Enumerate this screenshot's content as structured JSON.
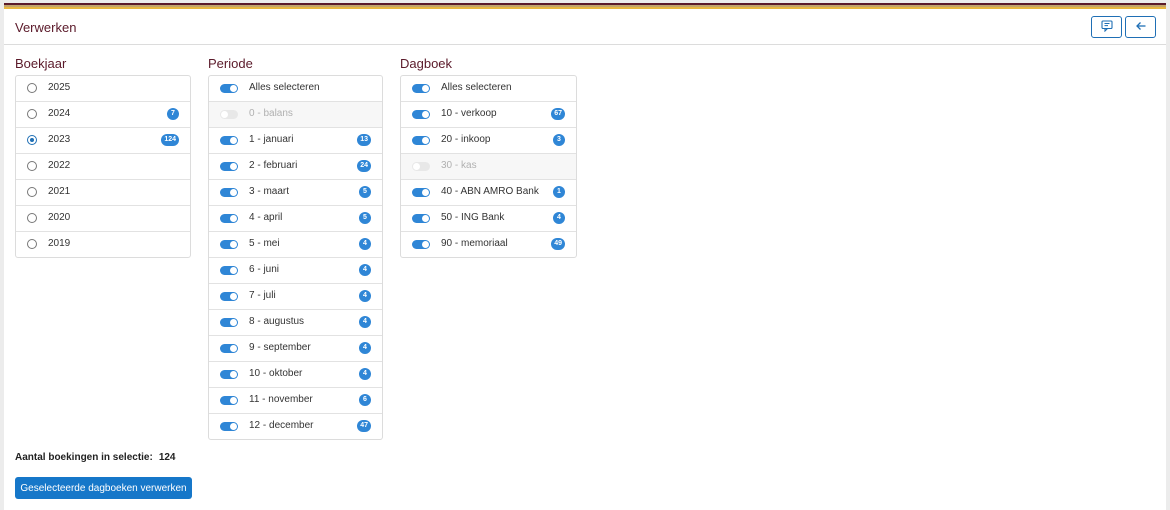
{
  "header": {
    "title": "Verwerken",
    "buttons": [
      {
        "icon": "feedback-icon"
      },
      {
        "icon": "arrow-left-icon"
      }
    ]
  },
  "colors": {
    "accent": "#1677c9",
    "toggle_on": "#2f86d6",
    "title": "#5b1a2a"
  },
  "boekjaar": {
    "title": "Boekjaar",
    "items": [
      {
        "label": "2025",
        "selected": false,
        "badge": ""
      },
      {
        "label": "2024",
        "selected": false,
        "badge": "7"
      },
      {
        "label": "2023",
        "selected": true,
        "badge": "124"
      },
      {
        "label": "2022",
        "selected": false,
        "badge": ""
      },
      {
        "label": "2021",
        "selected": false,
        "badge": ""
      },
      {
        "label": "2020",
        "selected": false,
        "badge": ""
      },
      {
        "label": "2019",
        "selected": false,
        "badge": ""
      }
    ]
  },
  "periode": {
    "title": "Periode",
    "items": [
      {
        "label": "Alles selecteren",
        "on": true,
        "disabled": false,
        "badge": ""
      },
      {
        "label": "0 - balans",
        "on": false,
        "disabled": true,
        "badge": ""
      },
      {
        "label": "1 - januari",
        "on": true,
        "disabled": false,
        "badge": "13"
      },
      {
        "label": "2 - februari",
        "on": true,
        "disabled": false,
        "badge": "24"
      },
      {
        "label": "3 - maart",
        "on": true,
        "disabled": false,
        "badge": "5"
      },
      {
        "label": "4 - april",
        "on": true,
        "disabled": false,
        "badge": "5"
      },
      {
        "label": "5 - mei",
        "on": true,
        "disabled": false,
        "badge": "4"
      },
      {
        "label": "6 - juni",
        "on": true,
        "disabled": false,
        "badge": "4"
      },
      {
        "label": "7 - juli",
        "on": true,
        "disabled": false,
        "badge": "4"
      },
      {
        "label": "8 - augustus",
        "on": true,
        "disabled": false,
        "badge": "4"
      },
      {
        "label": "9 - september",
        "on": true,
        "disabled": false,
        "badge": "4"
      },
      {
        "label": "10 - oktober",
        "on": true,
        "disabled": false,
        "badge": "4"
      },
      {
        "label": "11 - november",
        "on": true,
        "disabled": false,
        "badge": "6"
      },
      {
        "label": "12 - december",
        "on": true,
        "disabled": false,
        "badge": "47"
      }
    ]
  },
  "dagboek": {
    "title": "Dagboek",
    "items": [
      {
        "label": "Alles selecteren",
        "on": true,
        "disabled": false,
        "badge": ""
      },
      {
        "label": "10 - verkoop",
        "on": true,
        "disabled": false,
        "badge": "67"
      },
      {
        "label": "20 - inkoop",
        "on": true,
        "disabled": false,
        "badge": "3"
      },
      {
        "label": "30 - kas",
        "on": false,
        "disabled": true,
        "badge": ""
      },
      {
        "label": "40 - ABN AMRO Bank",
        "on": true,
        "disabled": false,
        "badge": "1"
      },
      {
        "label": "50 - ING Bank",
        "on": true,
        "disabled": false,
        "badge": "4"
      },
      {
        "label": "90 - memoriaal",
        "on": true,
        "disabled": false,
        "badge": "49"
      }
    ]
  },
  "summary": {
    "label": "Aantal boekingen in selectie:",
    "value": "124"
  },
  "action": {
    "label": "Geselecteerde dagboeken verwerken"
  }
}
